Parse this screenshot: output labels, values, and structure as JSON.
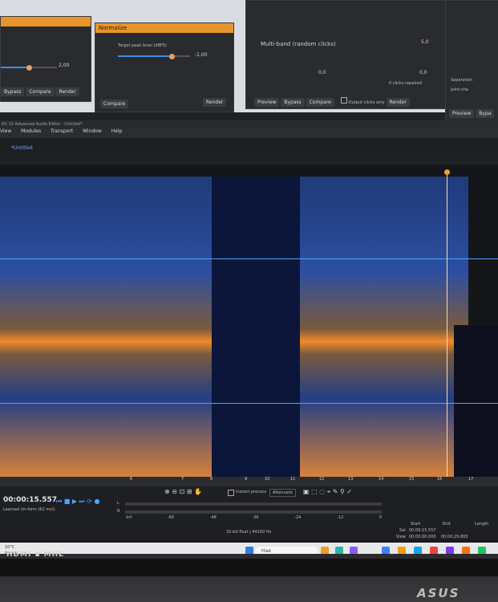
{
  "top_panels": {
    "left_panel": {
      "value": "2,00",
      "buttons": [
        "Bypass",
        "Compare",
        "Render"
      ]
    },
    "normalize": {
      "title": "Normalize",
      "target_label": "Target peak level (dBFS)",
      "target_value": "-1,00",
      "buttons": [
        "Compare",
        "Render"
      ]
    },
    "declick": {
      "mode": "Multi-band (random clicks)",
      "value_1": "5,0",
      "value_2": "0,0",
      "value_3": "0,0",
      "clicks_label": "0 clicks repaired",
      "buttons": [
        "Preview",
        "Bypass",
        "Compare",
        "Render"
      ],
      "checkbox_label": "Output clicks only"
    },
    "right_panel": {
      "labels": [
        "Separation",
        "Joint-cha"
      ],
      "buttons": [
        "Preview",
        "Bypa"
      ]
    }
  },
  "app": {
    "title": "RX 10 Advanced Audio Editor - Untitled*",
    "menu": [
      "View",
      "Modules",
      "Transport",
      "Window",
      "Help"
    ],
    "tab": "*Untitled"
  },
  "ruler": {
    "ticks": [
      "6",
      "7",
      "8",
      "9",
      "10",
      "11",
      "12",
      "13",
      "14",
      "15",
      "16",
      "17"
    ]
  },
  "transport": {
    "timecode": "00:00:15.557",
    "state": "Learned (In-form (62 ms))",
    "instant_process": "Instant process",
    "mode": "Attenuate",
    "bit_info": "32-bit float | 44100 Hz",
    "meter_scale": [
      "-Inf",
      "-70",
      "-60",
      "-57",
      "-54",
      "-51",
      "-48",
      "-45",
      "-42",
      "-39",
      "-36",
      "-33",
      "-30",
      "-27",
      "-24",
      "-21",
      "-18",
      "-15",
      "-12",
      "-9",
      "-6",
      "-3",
      "0"
    ],
    "sel_label": "Sel",
    "view_label": "View",
    "start_label": "Start",
    "end_label": "End",
    "length_label": "Length",
    "sel_start": "00:00:15.557",
    "view_start": "00:00:00.000",
    "view_end": "00:00:29.865",
    "length": "00:00:29.865",
    "l_label": "L",
    "r_label": "R"
  },
  "taskbar": {
    "search_placeholder": "Hae",
    "weather": "10°C",
    "weather_desc": "Pilvistä"
  },
  "bezel": {
    "brand": "HDMI ▪ MHL",
    "maker": "ASUS"
  }
}
